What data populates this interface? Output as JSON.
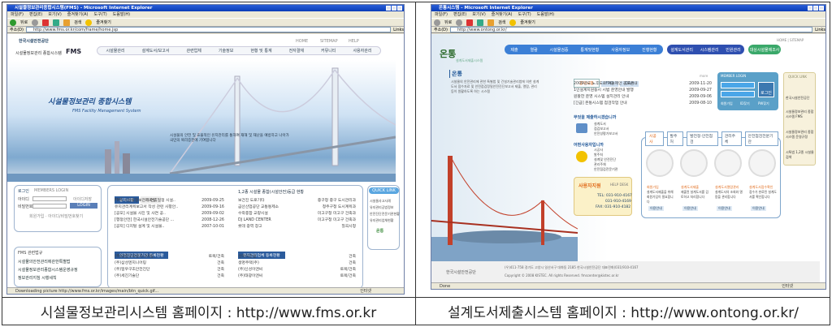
{
  "left": {
    "window_title": "시설물정보관리종합시스템(FMS) - Microsoft Internet Explorer",
    "menu": [
      "파일(F)",
      "편집(E)",
      "보기(V)",
      "즐겨찾기(A)",
      "도구(T)",
      "도움말(H)"
    ],
    "toolbar": [
      "뒤로",
      "검색",
      "즐겨찾기"
    ],
    "address_label": "주소(D)",
    "url": "http://www.fms.or.kr/com/frame/home.jsp",
    "links": "Links",
    "org": "한국시설안전공단",
    "system": "시설물정보관리 종합시스템",
    "brand": "FMS",
    "top_links": [
      "HOME",
      "SITEMAP",
      "HELP"
    ],
    "nav": [
      "시설물관리",
      "설계도서/보고서",
      "관련업체",
      "기술정보",
      "현황 및 통계",
      "전자결재",
      "커뮤니티",
      "사용자관리"
    ],
    "hero_title": "시설물정보관리 종합시스템",
    "hero_sub": "FMS Facility Management System",
    "hero_text": "시설물의 안전 및 효율적인 유지관리를 통하여 재해 및 재난을 예방하고 나아가 국민의 복리증진에 기여합니다",
    "login": {
      "title": "로그인",
      "subtitle": "MEMBERS LOGIN",
      "id_label": "아이디",
      "pw_label": "비밀번호",
      "save_id": "아이디저장",
      "button": "LOGIN",
      "links": "회원가입 · 아이디/비밀번호찾기"
    },
    "fms_links_title": "FMS 관련법규",
    "fms_links": [
      "시설물의안전관리에관한특별법",
      "시설물정보관리종합시스템운영규정",
      "정보관리지침 시행세칙"
    ],
    "notice_tabs": [
      "공지사항",
      "자료실"
    ],
    "notices": [
      [
        "FMS 시설물정보관리 연휴일정 시설..",
        "2009-09-25"
      ],
      [
        "유지관리계획보고서 작성 관련 사항안..",
        "2009-09-16"
      ],
      [
        "[공모] 시설물 사진 및 사연 공..",
        "2009-09-02"
      ],
      [
        "[행정안전] 한국시설안전기술공단 ...",
        "2008-12-26"
      ],
      [
        "[공지] 디지털 설계 및 시설물..",
        "2007-10-01"
      ]
    ],
    "rank_title": "1,2종 시설물 종합(시설안전)등급 현황",
    "rank": [
      [
        "보건진 도로기타",
        "중구청 중구 도시관리과"
      ],
      [
        "금산산업공단 교통통제소",
        "청주구청 도시계획과"
      ],
      [
        "수락종합 교량시설",
        "미고구청 미고구 건축과"
      ],
      [
        "DJ LAND CENTER",
        "미고구청 미고구 건축과"
      ],
      [
        "롯데 광역 창고",
        "칠곡시청"
      ]
    ],
    "company_title": "안전진단전문기관 등록현황",
    "companies": [
      [
        "(주)대한구조엔지니어링",
        "토목/건축"
      ],
      [
        "(주)삼성엔지니어링",
        "건축"
      ],
      [
        "(주)일우구조안전진단",
        "건축"
      ],
      [
        "(주)세진기술단",
        "건축"
      ]
    ],
    "maint_title": "유지관리업체 등록현황",
    "maint": [
      [
        "선마이건설",
        "건축"
      ],
      [
        "생명주택(주)",
        "건축"
      ],
      [
        "(주)신성이엔씨",
        "토목/건축"
      ],
      [
        "(주)태광이엔씨",
        "토목/건축"
      ]
    ],
    "quick_link": "QUICK LINK",
    "quick_items": [
      "시설물사고사례",
      "유지관리공법정보",
      "안전진단전문기관현황",
      "유지관리업체현황"
    ],
    "ontong_badge": "온통",
    "status": "Downloading picture http://www.fms.or.kr/images/main/btn_quick.gif...",
    "zone": "인터넷",
    "caption": "시설물정보관리시스템 홈페이지 : http://www.fms.or.kr"
  },
  "right": {
    "window_title": "온통시스템 - Microsoft Internet Explorer",
    "menu": [
      "파일(F)",
      "편집(E)",
      "보기(V)",
      "즐겨찾기(A)",
      "도구(T)",
      "도움말(H)"
    ],
    "toolbar": [
      "뒤로",
      "검색",
      "즐겨찾기"
    ],
    "address_label": "주소(D)",
    "url": "http://www.ontong.or.kr/",
    "links": "Links",
    "brand": "온통",
    "brand_sub": "설계도서제출시스템",
    "top_links": "HOME | SITEMAP",
    "nav_blue": [
      "제출",
      "열람",
      "시설물검증",
      "통계및현황",
      "사용자정보",
      "진행현황"
    ],
    "nav_dark": [
      "설계도서관리",
      "시스템관리",
      "민원관리"
    ],
    "nav_green": "대상시설물제조사",
    "intro_title": "온통",
    "intro_text": "시설물의 안전관리에 관한 특별법 및 건설기술관리법에 의한 설계도서 접수자료 및 안전점검정밀안전진단보고서 제출, 열람, 관리 등이 원활하도록 하는 시스템",
    "notice_tabs": [
      "공지사항",
      "FAQ",
      "Q&A"
    ],
    "more": "more",
    "notices": [
      [
        "2009년도 노후도로 기술제안 공모안내",
        "2009-11-20"
      ],
      [
        "1인설계지원동시 시범 운영안내 발행",
        "2009-09-27"
      ],
      [
        "원활한 운영 시스템 설치관리 안내",
        "2009-09-06"
      ],
      [
        "[긴급] 온통시스템 점검작업 안내",
        "2009-08-10"
      ]
    ],
    "member_login": {
      "title": "MEMBER LOGIN",
      "button": "로그인",
      "links": [
        "회원가입",
        "ID찾기",
        "PW찾기"
      ]
    },
    "submit_q": "무엇을 제출하시겠습니까",
    "submit_items": [
      "설계도서",
      "점검보고서",
      "안전성평가보고서"
    ],
    "user_q": "어떤사용자입니까",
    "user_items": [
      "시공사",
      "발주처",
      "설계및 안전진단",
      "관리주체",
      "안전점검전문기관"
    ],
    "help": {
      "title": "사용자지원",
      "sub": "HELP DESK",
      "tel": "TEL: 031-910-4167",
      "tel2": "031-910-4169",
      "fax": "FAX: 031-910-4182"
    },
    "service_tabs": [
      "시공사",
      "발주처",
      "발전정·안전점검",
      "관리주체",
      "안전점검전문기관"
    ],
    "services": [
      {
        "title": "회원가입",
        "text": "설계도서제출을 위해 회원가입이 필요합니다",
        "btn": "이용안내"
      },
      {
        "title": "설계도서제출",
        "text": "제출된 설계도서를 검토하고 처리합니다",
        "btn": "이용안내"
      },
      {
        "title": "설계도서열람관리",
        "text": "설계도서의 조회와 열람을 관리합니다",
        "btn": "이용안내"
      },
      {
        "title": "설계도서접수확인",
        "text": "접수가 완료된 설계도서를 확인합니다",
        "btn": "이용안내"
      }
    ],
    "quick_link": "QUICK LINK",
    "quick_items": [
      "한국시설안전공단",
      "시설물정보관리 종합시스템 FMS",
      "시설물정보관리 종합시스템 운영규정",
      "시특법 1,2종 시설물 검색"
    ],
    "footer_org": "한국시설안전공단",
    "footer_addr": "(우)411-758 경기도 고양시 일산서구 대화동 2185 한국시설안전공단 대표전화(031)910-4167",
    "footer_copy": "Copyright © 2008 KISTEC. All rights Reserved. fmscenter@kistec.or.kr",
    "status": "Done",
    "zone": "인터넷",
    "caption": "설계도서제출시스템 홈페이지 : http://www.ontong.or.kr/"
  },
  "colors": {
    "ie_title": "#0a3db8",
    "fms_nav": "#2b5b9c",
    "ontong_blue": "#3b7fd6",
    "ontong_green": "#3aa86a",
    "accent_orange": "#e06a1a"
  }
}
